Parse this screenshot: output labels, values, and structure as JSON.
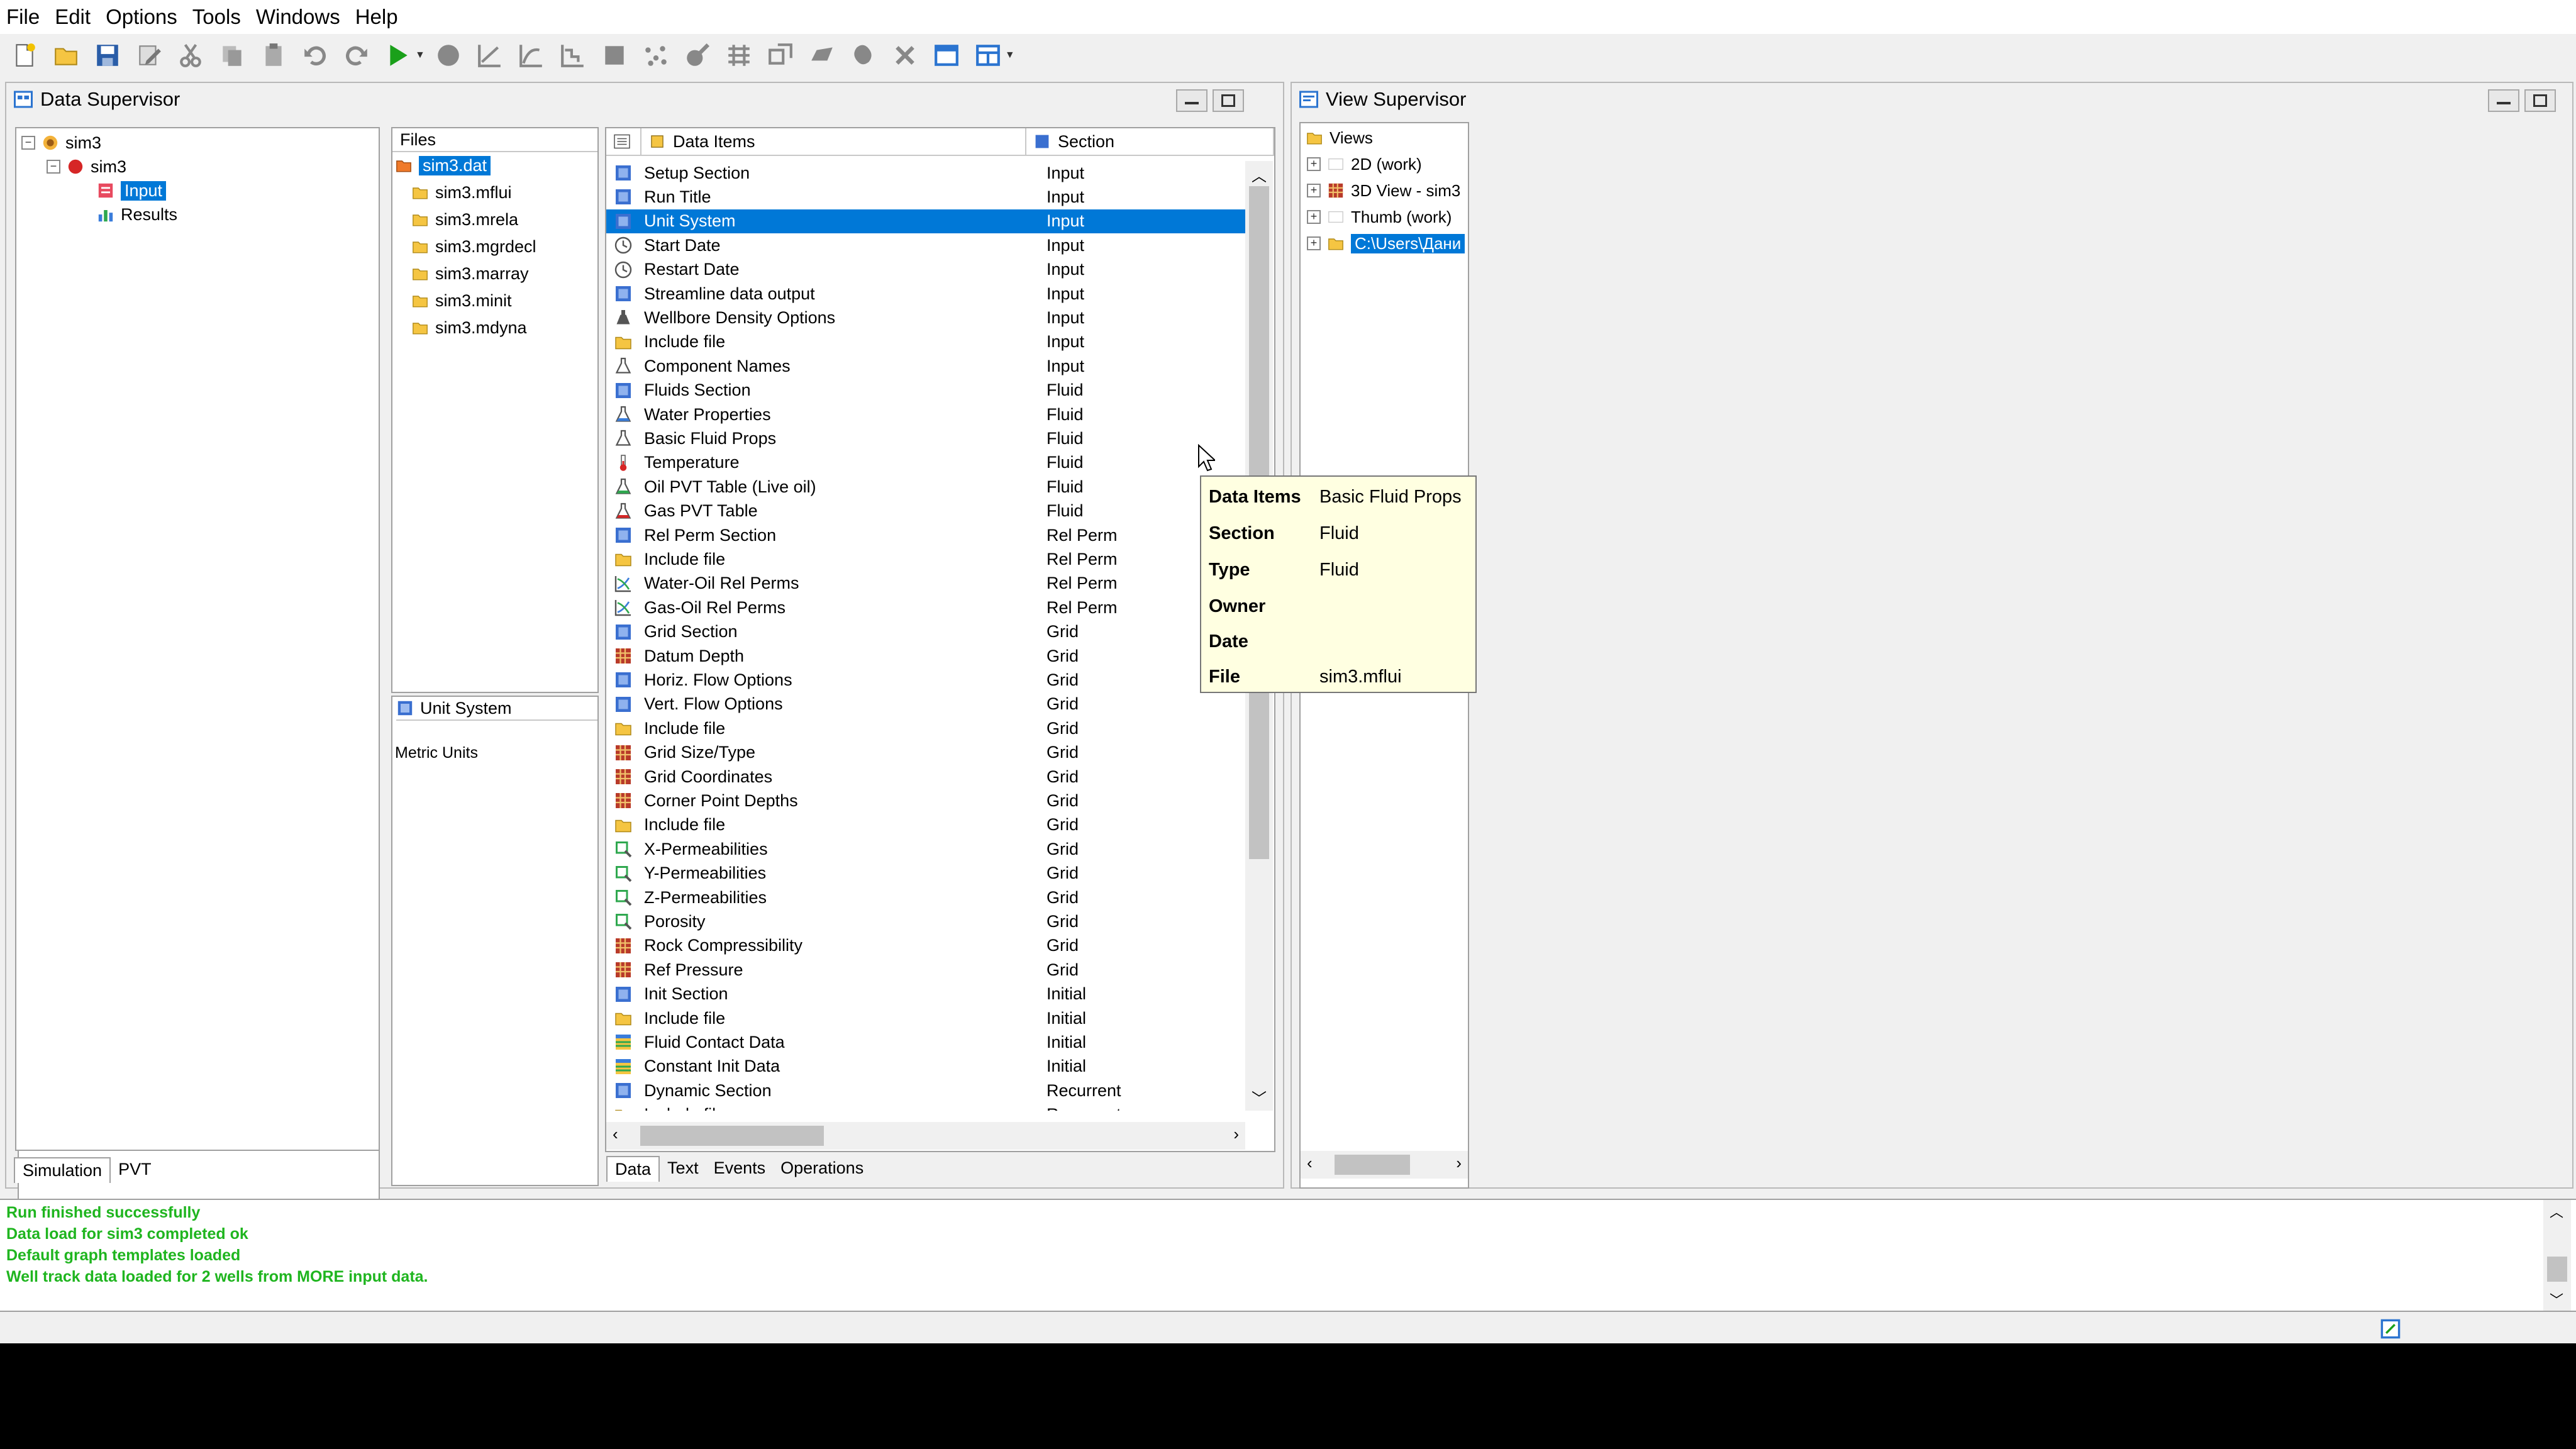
{
  "menu": [
    "File",
    "Edit",
    "Options",
    "Tools",
    "Windows",
    "Help"
  ],
  "data_supervisor": {
    "title": "Data Supervisor",
    "tree": {
      "root": "sim3",
      "child": "sim3",
      "items": [
        "Input",
        "Results"
      ]
    },
    "files_header": "Files",
    "files": [
      "sim3.dat",
      "sim3.mflui",
      "sim3.mrela",
      "sim3.mgrdecl",
      "sim3.marray",
      "sim3.minit",
      "sim3.mdyna"
    ],
    "detail": {
      "title": "Unit System",
      "value": "Metric Units"
    },
    "left_tabs": [
      "Simulation",
      "PVT"
    ],
    "grid_headers": {
      "items": "Data Items",
      "section": "Section"
    },
    "rows": [
      {
        "item": "Setup Section",
        "section": "Input",
        "icon": "section-icon"
      },
      {
        "item": "Run Title",
        "section": "Input",
        "icon": "section-icon"
      },
      {
        "item": "Unit System",
        "section": "Input",
        "icon": "section-icon"
      },
      {
        "item": "Start Date",
        "section": "Input",
        "icon": "clock-icon"
      },
      {
        "item": "Restart Date",
        "section": "Input",
        "icon": "clock-icon"
      },
      {
        "item": "Streamline data output",
        "section": "Input",
        "icon": "section-icon"
      },
      {
        "item": "Wellbore Density Options",
        "section": "Input",
        "icon": "well-icon"
      },
      {
        "item": "Include file",
        "section": "Input",
        "icon": "folder-icon"
      },
      {
        "item": "Component Names",
        "section": "Input",
        "icon": "flask-icon"
      },
      {
        "item": "Fluids Section",
        "section": "Fluid",
        "icon": "section-icon"
      },
      {
        "item": "Water Properties",
        "section": "Fluid",
        "icon": "flask-blue-icon"
      },
      {
        "item": "Basic Fluid Props",
        "section": "Fluid",
        "icon": "flask-icon"
      },
      {
        "item": "Temperature",
        "section": "Fluid",
        "icon": "thermometer-icon"
      },
      {
        "item": "Oil PVT Table (Live oil)",
        "section": "Fluid",
        "icon": "flask-green-icon"
      },
      {
        "item": "Gas PVT Table",
        "section": "Fluid",
        "icon": "flask-red-icon"
      },
      {
        "item": "Rel Perm Section",
        "section": "Rel Perm",
        "icon": "section-icon"
      },
      {
        "item": "Include file",
        "section": "Rel Perm",
        "icon": "folder-icon"
      },
      {
        "item": "Water-Oil Rel Perms",
        "section": "Rel Perm",
        "icon": "graph-icon"
      },
      {
        "item": "Gas-Oil Rel Perms",
        "section": "Rel Perm",
        "icon": "graph-icon"
      },
      {
        "item": "Grid Section",
        "section": "Grid",
        "icon": "section-icon"
      },
      {
        "item": "Datum Depth",
        "section": "Grid",
        "icon": "grid-icon"
      },
      {
        "item": "Horiz. Flow Options",
        "section": "Grid",
        "icon": "section-icon"
      },
      {
        "item": "Vert. Flow Options",
        "section": "Grid",
        "icon": "section-icon"
      },
      {
        "item": "Include file",
        "section": "Grid",
        "icon": "folder-icon"
      },
      {
        "item": "Grid Size/Type",
        "section": "Grid",
        "icon": "grid-icon"
      },
      {
        "item": "Grid Coordinates",
        "section": "Grid",
        "icon": "grid-icon"
      },
      {
        "item": "Corner Point Depths",
        "section": "Grid",
        "icon": "grid-icon"
      },
      {
        "item": "Include file",
        "section": "Grid",
        "icon": "folder-icon"
      },
      {
        "item": "X-Permeabilities",
        "section": "Grid",
        "icon": "perm-icon"
      },
      {
        "item": "Y-Permeabilities",
        "section": "Grid",
        "icon": "perm-icon"
      },
      {
        "item": "Z-Permeabilities",
        "section": "Grid",
        "icon": "perm-icon"
      },
      {
        "item": "Porosity",
        "section": "Grid",
        "icon": "perm-icon"
      },
      {
        "item": "Rock Compressibility",
        "section": "Grid",
        "icon": "grid-icon"
      },
      {
        "item": "Ref Pressure",
        "section": "Grid",
        "icon": "grid-icon"
      },
      {
        "item": "Init Section",
        "section": "Initial",
        "icon": "section-icon"
      },
      {
        "item": "Include file",
        "section": "Initial",
        "icon": "folder-icon"
      },
      {
        "item": "Fluid Contact Data",
        "section": "Initial",
        "icon": "table-icon"
      },
      {
        "item": "Constant Init Data",
        "section": "Initial",
        "icon": "table-icon"
      },
      {
        "item": "Dynamic Section",
        "section": "Recurrent",
        "icon": "section-icon"
      },
      {
        "item": "Include file",
        "section": "Recurrent",
        "icon": "folder-icon"
      }
    ],
    "selected_row": 2,
    "grid_tabs": [
      "Data",
      "Text",
      "Events",
      "Operations"
    ]
  },
  "tooltip": [
    {
      "key": "Data Items",
      "value": "Basic Fluid Props"
    },
    {
      "key": "Section",
      "value": "Fluid"
    },
    {
      "key": "Type",
      "value": "Fluid"
    },
    {
      "key": "Owner",
      "value": ""
    },
    {
      "key": "Date",
      "value": ""
    },
    {
      "key": "File",
      "value": "sim3.mflui"
    }
  ],
  "view_supervisor": {
    "title": "View Supervisor",
    "root": "Views",
    "items": [
      "2D (work)",
      "3D View - sim3",
      "Thumb (work)",
      "C:\\Users\\Дани"
    ]
  },
  "log": [
    "Run finished successfully",
    "Data load for sim3 completed ok",
    "Default graph templates loaded",
    "Well track data loaded for 2 wells from MORE input data."
  ],
  "colors": {
    "selection": "#0078d7",
    "log_text": "#1fb51f",
    "tooltip_bg": "#ffffe1"
  }
}
